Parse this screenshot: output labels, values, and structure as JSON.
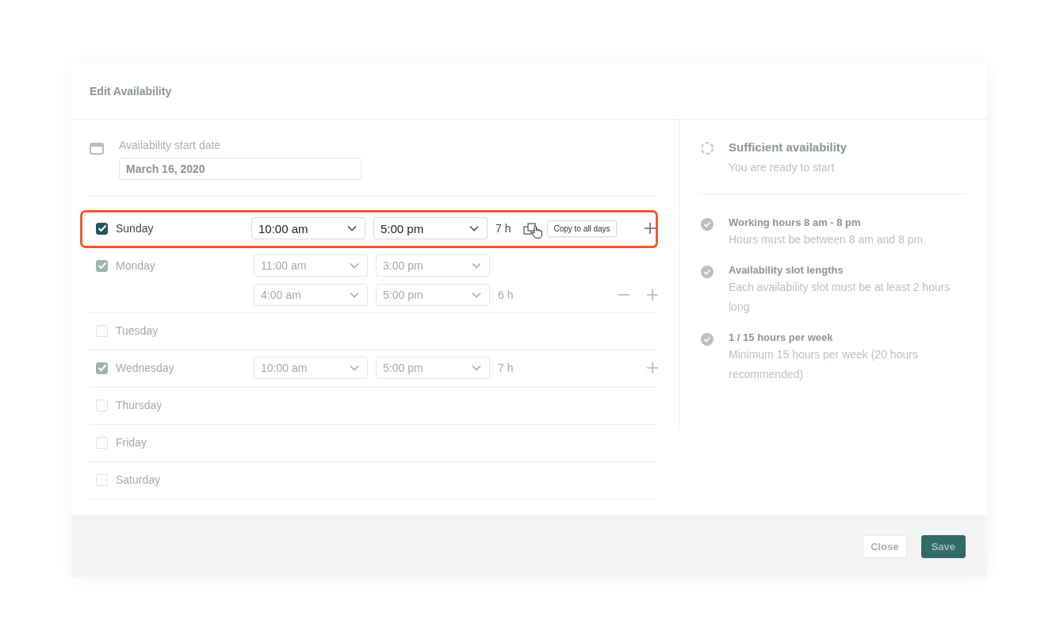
{
  "dialog": {
    "title": "Edit Availability"
  },
  "start_date": {
    "label": "Availability start date",
    "value": "March 16, 2020"
  },
  "days": [
    {
      "name": "Sunday",
      "checked": true,
      "focused": true,
      "slots": [
        {
          "start": "10:00 am",
          "end": "5:00 pm"
        }
      ],
      "total": "7 h",
      "copy_tooltip": "Copy to all days",
      "actions": [
        {
          "kind": "add"
        }
      ]
    },
    {
      "name": "Monday",
      "checked": true,
      "focused": false,
      "slots": [
        {
          "start": "11:00 am",
          "end": "3:00 pm"
        },
        {
          "start": "4:00 am",
          "end": "5:00 pm"
        }
      ],
      "total": "6 h",
      "actions": [
        {
          "kind": "remove"
        },
        {
          "kind": "add"
        }
      ]
    },
    {
      "name": "Tuesday",
      "checked": false,
      "focused": false
    },
    {
      "name": "Wednesday",
      "checked": true,
      "focused": false,
      "slots": [
        {
          "start": "10:00 am",
          "end": "5:00 pm"
        }
      ],
      "total": "7 h",
      "actions": [
        {
          "kind": "add"
        }
      ]
    },
    {
      "name": "Thursday",
      "checked": false,
      "focused": false
    },
    {
      "name": "Friday",
      "checked": false,
      "focused": false
    },
    {
      "name": "Saturday",
      "checked": false,
      "focused": false
    }
  ],
  "summary": {
    "title": "Sufficient availability",
    "subtitle": "You are ready to start",
    "passed": false
  },
  "checks": [
    {
      "title": "Working hours 8 am - 8 pm",
      "description": "Hours must be between 8 am and 8 pm.",
      "passed": true
    },
    {
      "title": "Availability slot lengths",
      "description": "Each availability slot must be at least 2 hours long",
      "passed": true
    },
    {
      "title": "1 / 15  hours per week",
      "description": "Minimum 15 hours per week (20 hours recommended)",
      "passed": true
    }
  ],
  "buttons": [
    {
      "label": "Close",
      "kind": "secondary"
    },
    {
      "label": "Save",
      "kind": "primary"
    }
  ]
}
